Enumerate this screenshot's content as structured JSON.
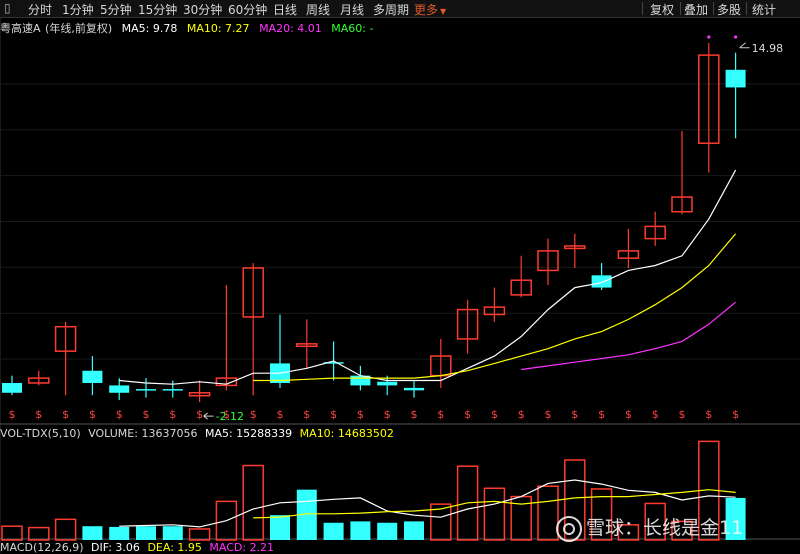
{
  "toolbar": {
    "intervals": [
      "分时",
      "1分钟",
      "5分钟",
      "15分钟",
      "30分钟",
      "60分钟",
      "日线",
      "周线",
      "月线",
      "多周期"
    ],
    "more": "更多",
    "right": [
      "复权",
      "叠加",
      "多股",
      "统计"
    ]
  },
  "header": {
    "stock": "粤高速A",
    "mode": "(年线,前复权)",
    "ma5": "MA5: 9.78",
    "ma10": "MA10: 7.27",
    "ma20": "MA20: 4.01",
    "ma60": "MA60: -"
  },
  "volume_header": {
    "label": "VOL-TDX(5,10)",
    "volume": "VOLUME: 13637056",
    "ma5": "MA5: 15288339",
    "ma10": "MA10: 14683502"
  },
  "macd_header": {
    "label": "MACD(12,26,9)",
    "dif": "DIF: 3.06",
    "dea": "DEA: 1.95",
    "macd": "MACD: 2.21"
  },
  "annotations": {
    "high": "14.98",
    "low": "2.12",
    "dividend_marker": "$"
  },
  "watermark": "雪球：长线是金11",
  "colors": {
    "up": "#ff3b30",
    "down": "#33ffff",
    "ma5": "#ffffff",
    "ma10": "#ffff00",
    "ma20": "#ff33ff",
    "ma60": "#33ff33"
  },
  "chart_data": {
    "type": "candlestick",
    "title": "粤高速A (年线,前复权)",
    "candles": [
      {
        "o": 2.9,
        "c": 2.5,
        "h": 3.2,
        "l": 2.4
      },
      {
        "o": 2.9,
        "c": 3.1,
        "h": 3.4,
        "l": 2.8
      },
      {
        "o": 4.2,
        "c": 5.2,
        "h": 5.4,
        "l": 2.4
      },
      {
        "o": 3.4,
        "c": 2.9,
        "h": 4.0,
        "l": 2.4
      },
      {
        "o": 2.8,
        "c": 2.5,
        "h": 3.1,
        "l": 2.2
      },
      {
        "o": 2.65,
        "c": 2.6,
        "h": 3.1,
        "l": 2.3
      },
      {
        "o": 2.65,
        "c": 2.6,
        "h": 3.0,
        "l": 2.3
      },
      {
        "o": 2.38,
        "c": 2.5,
        "h": 3.0,
        "l": 2.12
      },
      {
        "o": 2.8,
        "c": 3.1,
        "h": 6.9,
        "l": 2.6
      },
      {
        "o": 5.6,
        "c": 7.6,
        "h": 7.8,
        "l": 2.4
      },
      {
        "o": 3.7,
        "c": 2.9,
        "h": 5.7,
        "l": 2.7
      },
      {
        "o": 4.4,
        "c": 4.5,
        "h": 5.5,
        "l": 3.5
      },
      {
        "o": 3.75,
        "c": 3.7,
        "h": 4.6,
        "l": 3.0
      },
      {
        "o": 3.2,
        "c": 2.8,
        "h": 3.6,
        "l": 2.6
      },
      {
        "o": 2.95,
        "c": 2.8,
        "h": 3.2,
        "l": 2.4
      },
      {
        "o": 2.7,
        "c": 2.6,
        "h": 3.0,
        "l": 2.3
      },
      {
        "o": 3.2,
        "c": 4.0,
        "h": 4.7,
        "l": 2.7
      },
      {
        "o": 4.7,
        "c": 5.9,
        "h": 6.3,
        "l": 4.1
      },
      {
        "o": 5.7,
        "c": 6.0,
        "h": 6.8,
        "l": 5.4
      },
      {
        "o": 6.5,
        "c": 7.1,
        "h": 8.1,
        "l": 6.4
      },
      {
        "o": 7.5,
        "c": 8.3,
        "h": 8.8,
        "l": 6.9
      },
      {
        "o": 8.4,
        "c": 8.5,
        "h": 9.0,
        "l": 7.6
      },
      {
        "o": 7.3,
        "c": 6.8,
        "h": 7.8,
        "l": 6.7
      },
      {
        "o": 8.0,
        "c": 8.3,
        "h": 9.2,
        "l": 7.6
      },
      {
        "o": 8.8,
        "c": 9.3,
        "h": 9.9,
        "l": 8.5
      },
      {
        "o": 9.9,
        "c": 10.5,
        "h": 13.2,
        "l": 9.8
      },
      {
        "o": 12.7,
        "c": 16.3,
        "h": 16.8,
        "l": 11.5
      },
      {
        "o": 15.7,
        "c": 14.98,
        "h": 16.4,
        "l": 12.9
      }
    ],
    "ma5": [
      null,
      null,
      null,
      null,
      3.0,
      2.9,
      2.85,
      2.95,
      2.85,
      3.3,
      3.3,
      3.5,
      3.8,
      3.2,
      3.0,
      3.0,
      3.0,
      3.5,
      4.0,
      4.8,
      5.9,
      6.8,
      7.0,
      7.5,
      7.7,
      8.1,
      9.6,
      11.6
    ],
    "ma10": [
      null,
      null,
      null,
      null,
      null,
      null,
      null,
      null,
      null,
      3.0,
      3.0,
      3.05,
      3.1,
      3.1,
      3.1,
      3.1,
      3.2,
      3.4,
      3.7,
      4.0,
      4.3,
      4.7,
      5.0,
      5.5,
      6.1,
      6.8,
      7.7,
      9.0
    ],
    "ma20": [
      null,
      null,
      null,
      null,
      null,
      null,
      null,
      null,
      null,
      null,
      null,
      null,
      null,
      null,
      null,
      null,
      null,
      null,
      null,
      3.45,
      3.6,
      3.75,
      3.9,
      4.05,
      4.3,
      4.6,
      5.3,
      6.2
    ],
    "volume": [
      2.0,
      1.8,
      3.0,
      2.0,
      1.9,
      2.0,
      2.0,
      1.6,
      5.6,
      10.8,
      3.6,
      7.3,
      2.5,
      2.7,
      2.5,
      2.7,
      5.2,
      10.7,
      7.5,
      6.3,
      7.8,
      11.6,
      7.4,
      2.2,
      5.3,
      2.7,
      14.3,
      6.1
    ],
    "volume_dir": [
      "up",
      "up",
      "up",
      "down",
      "down",
      "down",
      "down",
      "up",
      "up",
      "up",
      "down",
      "down",
      "down",
      "down",
      "down",
      "down",
      "up",
      "up",
      "up",
      "up",
      "up",
      "up",
      "up",
      "up",
      "up",
      "up",
      "up",
      "down"
    ],
    "vol_ma5": [
      null,
      null,
      null,
      null,
      2.0,
      2.1,
      2.2,
      1.9,
      2.8,
      4.5,
      5.4,
      5.6,
      5.9,
      6.1,
      4.2,
      3.6,
      3.3,
      4.5,
      5.2,
      6.3,
      8.2,
      8.7,
      8.1,
      7.2,
      6.9,
      5.8,
      6.4,
      6.2
    ],
    "vol_ma10": [
      null,
      null,
      null,
      null,
      null,
      null,
      null,
      null,
      null,
      3.2,
      3.3,
      3.8,
      3.8,
      3.9,
      4.1,
      4.2,
      4.5,
      5.4,
      5.6,
      5.2,
      5.6,
      6.1,
      6.3,
      6.3,
      6.6,
      6.9,
      7.3,
      6.9
    ],
    "ylim": [
      2.0,
      17.0
    ]
  }
}
